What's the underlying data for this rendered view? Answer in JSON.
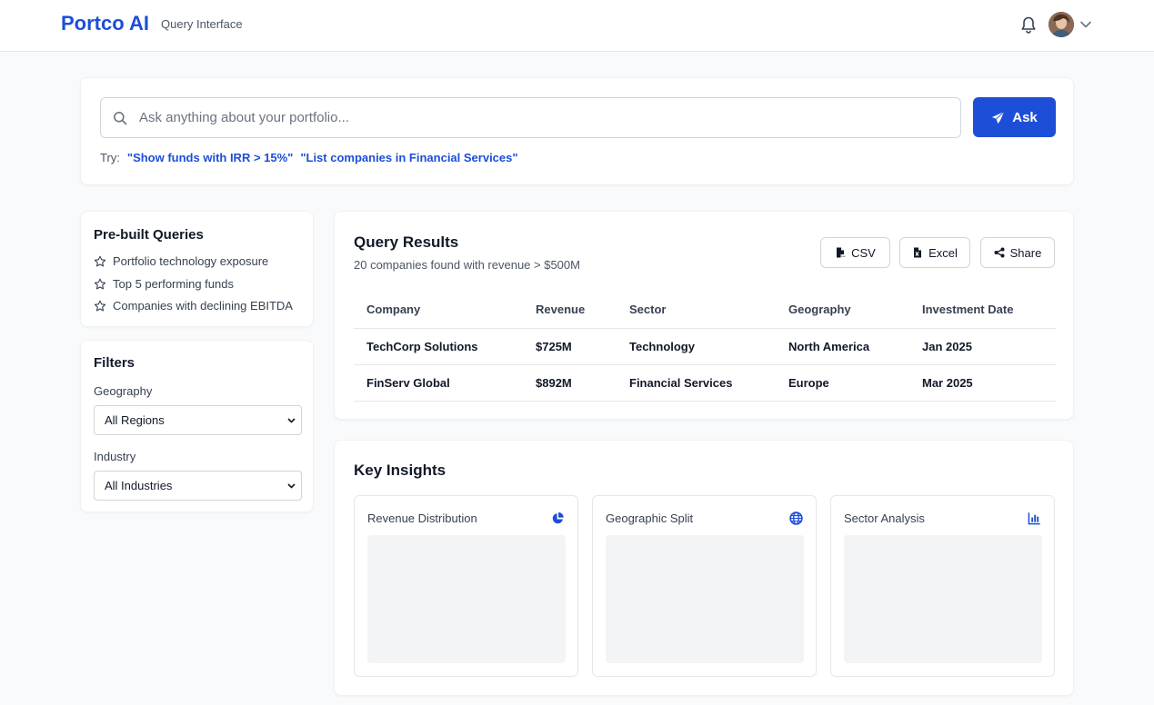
{
  "header": {
    "brand": "Portco AI",
    "subtitle": "Query Interface",
    "icons": [
      "bell-icon",
      "avatar",
      "chevron-down-icon"
    ]
  },
  "search": {
    "placeholder": "Ask anything about your portfolio...",
    "value": "",
    "ask_label": "Ask",
    "try_label": "Try:",
    "suggestions": [
      "\"Show funds with IRR > 15%\"",
      "\"List companies in Financial Services\""
    ]
  },
  "prebuilt": {
    "title": "Pre-built Queries",
    "items": [
      {
        "label": "Portfolio technology exposure",
        "icon": "star-icon"
      },
      {
        "label": "Top 5 performing funds",
        "icon": "star-icon"
      },
      {
        "label": "Companies with declining EBITDA",
        "icon": "star-icon"
      }
    ]
  },
  "filters": {
    "title": "Filters",
    "geography": {
      "label": "Geography",
      "selected": "All Regions"
    },
    "industry": {
      "label": "Industry",
      "selected": "All Industries"
    }
  },
  "results": {
    "title": "Query Results",
    "subtitle": "20 companies found with revenue > $500M",
    "actions": {
      "csv": "CSV",
      "excel": "Excel",
      "share": "Share"
    },
    "columns": [
      "Company",
      "Revenue",
      "Sector",
      "Geography",
      "Investment Date"
    ],
    "rows": [
      [
        "TechCorp Solutions",
        "$725M",
        "Technology",
        "North America",
        "Jan 2025"
      ],
      [
        "FinServ Global",
        "$892M",
        "Financial Services",
        "Europe",
        "Mar 2025"
      ]
    ]
  },
  "insights": {
    "title": "Key Insights",
    "cards": [
      {
        "title": "Revenue Distribution",
        "icon": "pie-chart-icon"
      },
      {
        "title": "Geographic Split",
        "icon": "globe-icon"
      },
      {
        "title": "Sector Analysis",
        "icon": "bar-chart-icon"
      }
    ]
  },
  "colors": {
    "accent": "#1d4ed8",
    "background": "#f9fafb",
    "border": "#e5e7eb"
  }
}
